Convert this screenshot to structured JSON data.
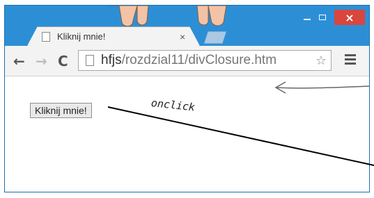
{
  "window": {
    "controls": {
      "minimize": "minimize",
      "maximize": "maximize",
      "close": "×"
    }
  },
  "tab": {
    "title": "Kliknij mnie!",
    "close": "×"
  },
  "toolbar": {
    "back": "←",
    "forward": "→",
    "reload": "C",
    "url_host": "hfjs",
    "url_path": "/rozdzial11/divClosure.htm",
    "star": "☆"
  },
  "page": {
    "button_label": "Kliknij mnie!"
  },
  "annotation": {
    "text": "onclick"
  },
  "colors": {
    "chrome_frame": "#2c8fd6",
    "close_button": "#d9463e"
  },
  "icons": [
    "page-icon",
    "back-arrow-icon",
    "forward-arrow-icon",
    "reload-icon",
    "star-icon",
    "menu-icon",
    "minimize-icon",
    "maximize-icon",
    "close-icon",
    "hands-illustration"
  ]
}
